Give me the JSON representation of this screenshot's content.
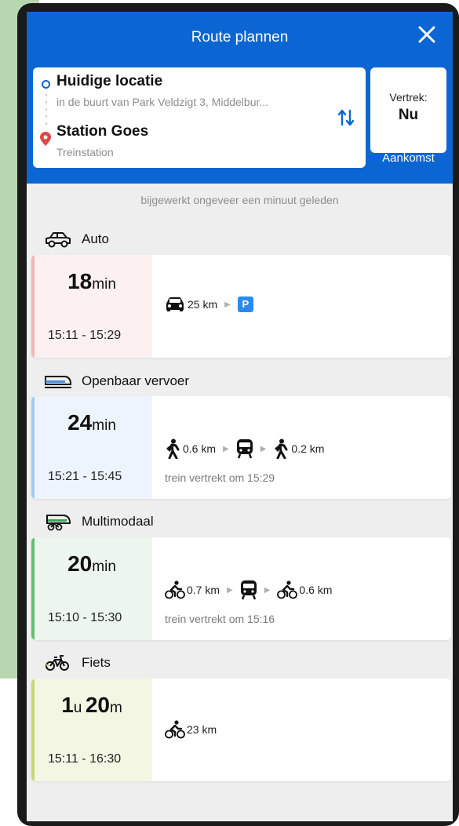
{
  "header": {
    "title": "Route plannen",
    "origin_name": "Huidige locatie",
    "origin_sub": "in de buurt van Park Veldzigt 3, Middelbur...",
    "destination_name": "Station Goes",
    "destination_sub": "Treinstation",
    "departure_label": "Vertrek:",
    "departure_value": "Nu",
    "arrival_link": "Aankomst"
  },
  "status_text": "bijgewerkt ongeveer een minuut geleden",
  "sections": [
    {
      "label": "Auto",
      "icon": "car-outline-icon"
    },
    {
      "label": "Openbaar vervoer",
      "icon": "train-icon"
    },
    {
      "label": "Multimodaal",
      "icon": "bike-train-icon"
    },
    {
      "label": "Fiets",
      "icon": "bike-icon"
    }
  ],
  "routes": [
    {
      "dur_big": "18",
      "dur_small": "min",
      "times": "15:11 - 15:29",
      "color": "#f0b7b7",
      "tint": "#fdf0f0",
      "legs": [
        "25 km"
      ],
      "note": ""
    },
    {
      "dur_big": "24",
      "dur_small": "min",
      "times": "15:21 - 15:45",
      "color": "#a6c7f0",
      "tint": "#eef4fd",
      "legs": [
        "0.6 km",
        "0.2 km"
      ],
      "note": "trein vertrekt om 15:29"
    },
    {
      "dur_big": "20",
      "dur_small": "min",
      "times": "15:10 - 15:30",
      "color": "#5fbf74",
      "tint": "#ecf6ee",
      "legs": [
        "0.7 km",
        "0.6 km"
      ],
      "note": "trein vertrekt om 15:16"
    },
    {
      "dur_big1": "1",
      "dur_small1": "u",
      "dur_big2": "20",
      "dur_small2": "m",
      "times": "15:11 - 16:30",
      "color": "#c4d970",
      "tint": "#f3f6e3",
      "legs": [
        "23 km"
      ],
      "note": ""
    }
  ],
  "parking_badge": "P",
  "colors": {
    "brand_blue": "#0b66d3",
    "background": "#eeeeee"
  }
}
